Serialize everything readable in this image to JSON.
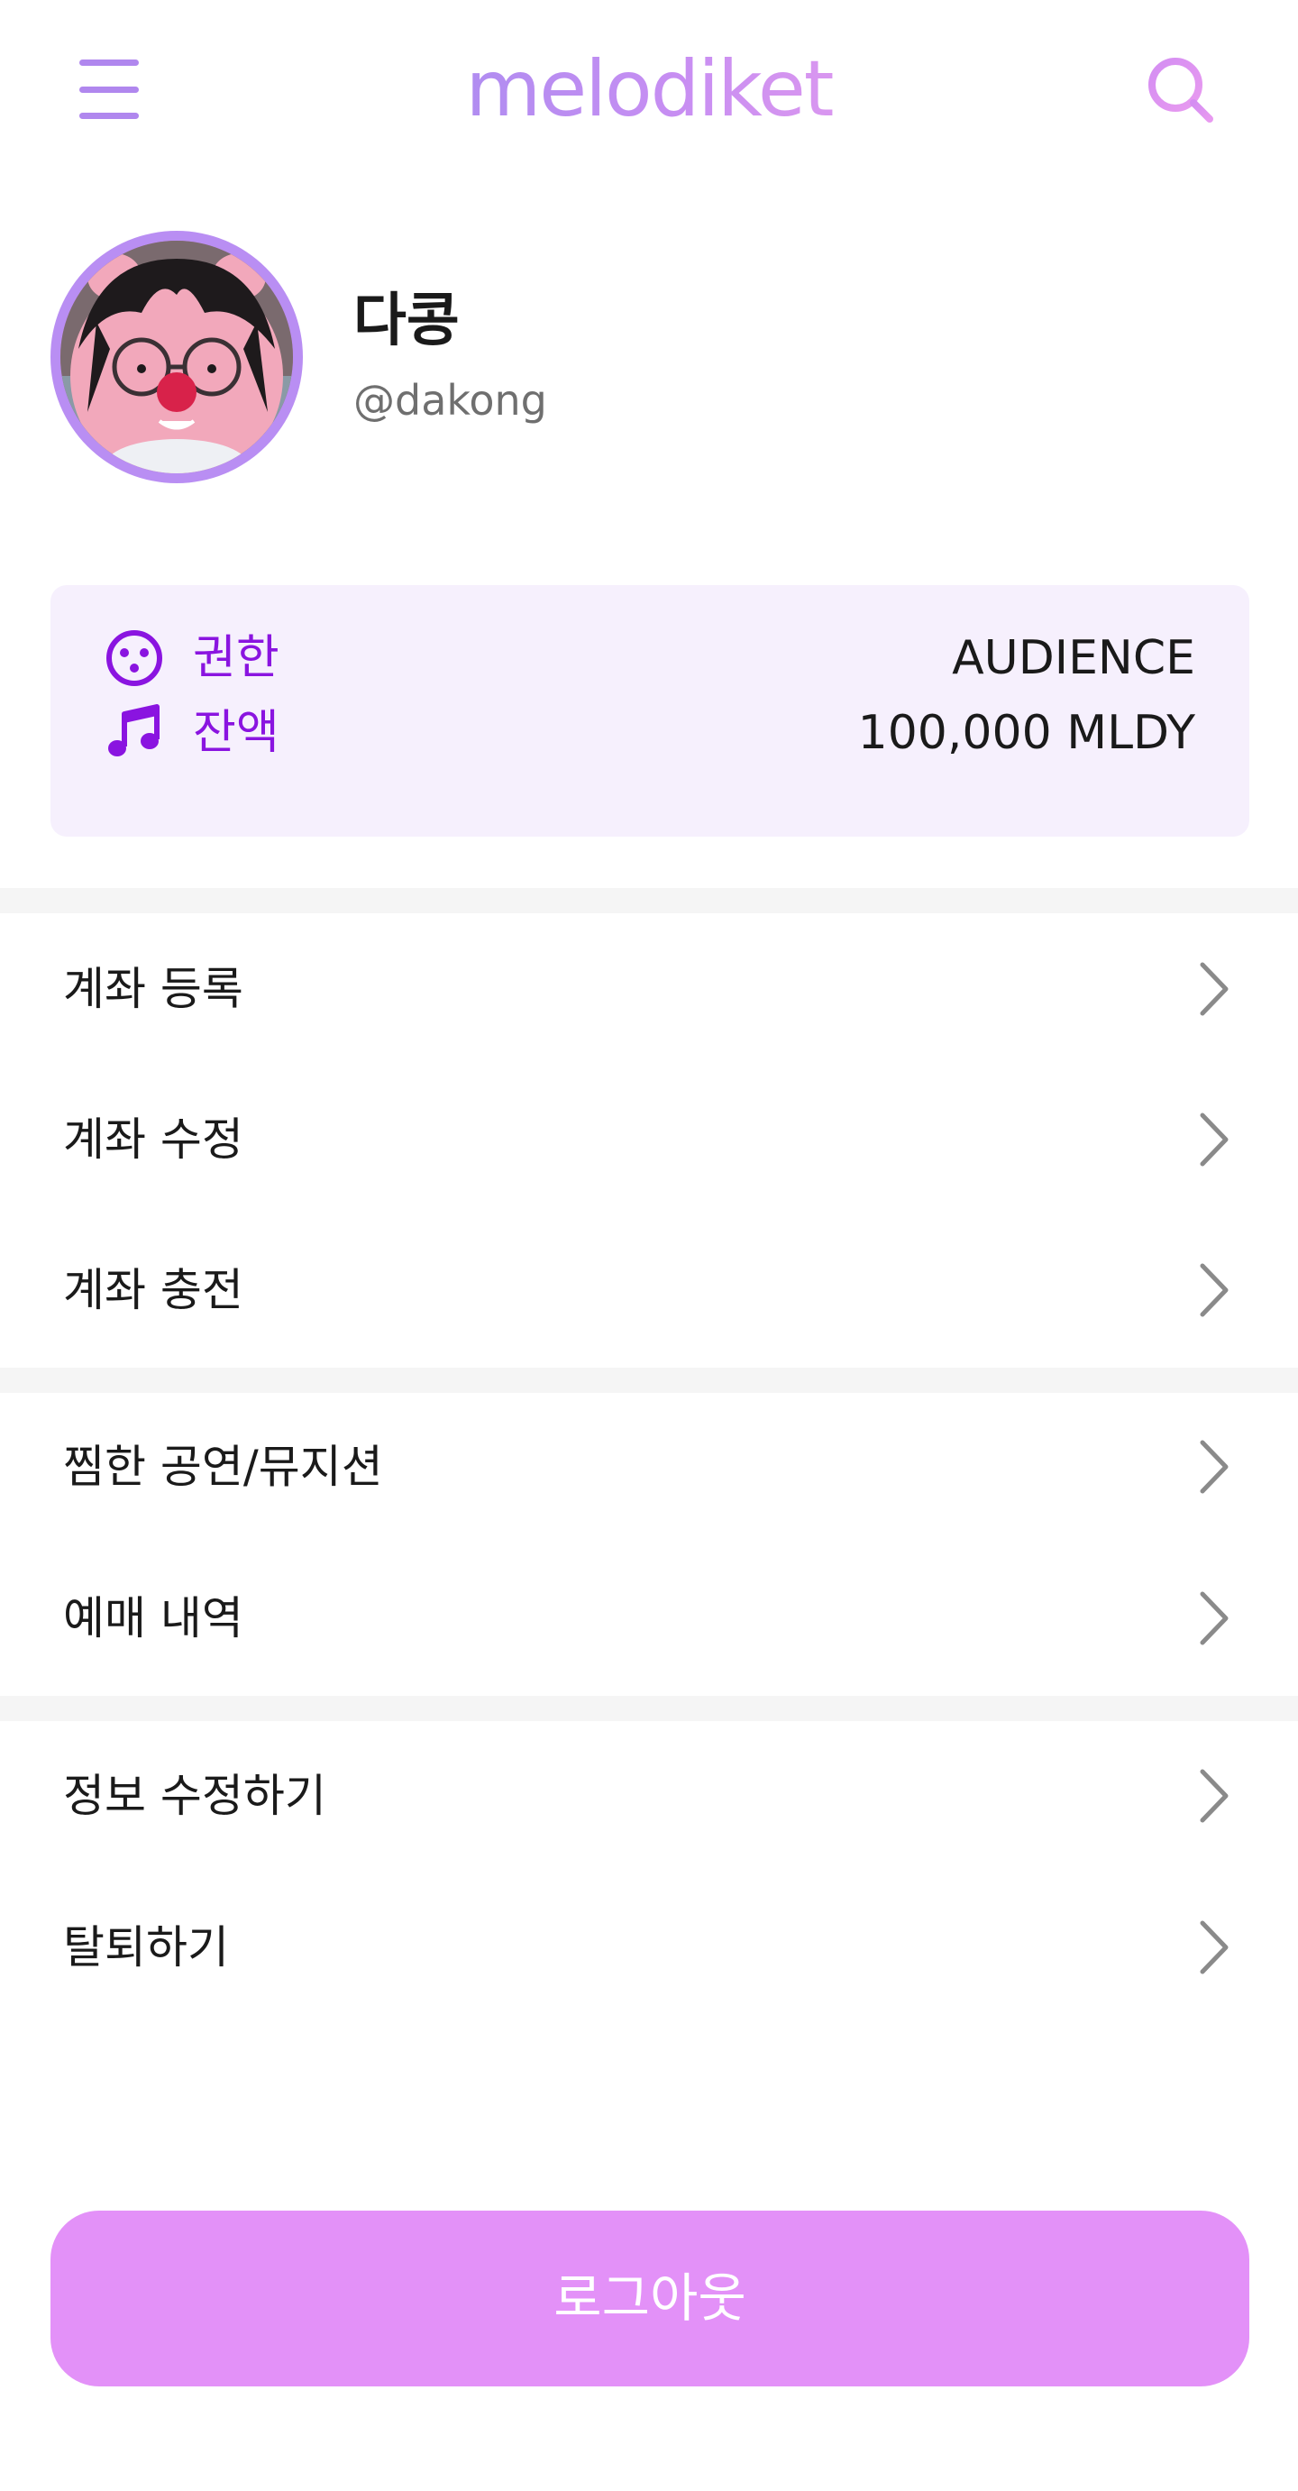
{
  "header": {
    "logo": "melodiket",
    "menu_icon": "hamburger-menu-icon",
    "search_icon": "search-icon",
    "brand_colors": [
      "#a78cf0",
      "#c78ef2",
      "#e39bee"
    ]
  },
  "profile": {
    "name": "다콩",
    "handle": "@dakong",
    "avatar_ring_color": "#b98ef3"
  },
  "info": {
    "role_label": "권한",
    "role_value": "AUDIENCE",
    "role_icon": "smile-face-icon",
    "balance_label": "잔액",
    "balance_value": "100,000 MLDY",
    "balance_icon": "music-note-icon",
    "accent_color": "#8a14e0"
  },
  "menu": {
    "account": [
      {
        "label": "계좌 등록"
      },
      {
        "label": "계좌 수정"
      },
      {
        "label": "계좌 충전"
      }
    ],
    "activity": [
      {
        "label": "찜한 공연/뮤지션"
      },
      {
        "label": "예매 내역"
      }
    ],
    "settings": [
      {
        "label": "정보 수정하기"
      },
      {
        "label": "탈퇴하기"
      }
    ],
    "chevron_icon": "chevron-right-icon"
  },
  "logout": {
    "label": "로그아웃",
    "color": "#e391f8"
  }
}
